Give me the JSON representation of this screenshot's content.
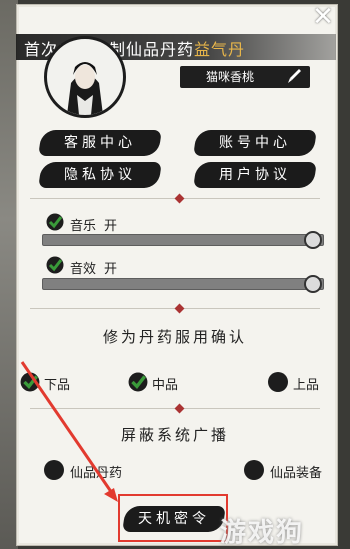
{
  "banner": {
    "prefix": "首次成功炼制仙品丹药",
    "highlight": "益气丹"
  },
  "player": {
    "name": "猫咪香桃"
  },
  "buttons": {
    "customer_service": "客服中心",
    "account_center": "账号中心",
    "privacy_policy": "隐私协议",
    "user_agreement": "用户协议"
  },
  "audio": {
    "music": {
      "label": "音乐",
      "state": "开",
      "level": 1.0
    },
    "sfx": {
      "label": "音效",
      "state": "开",
      "level": 1.0
    }
  },
  "pill_confirm": {
    "title": "修为丹药服用确认",
    "options": [
      {
        "label": "下品",
        "checked": true
      },
      {
        "label": "中品",
        "checked": true
      },
      {
        "label": "上品",
        "checked": false
      }
    ]
  },
  "broadcast": {
    "title": "屏蔽系统广播",
    "options": [
      {
        "label": "仙品丹药",
        "checked": false
      },
      {
        "label": "仙品装备",
        "checked": false
      }
    ]
  },
  "secret_button": "天机密令",
  "watermark": "游戏狗",
  "colors": {
    "accent": "#e8b64a",
    "highlight_box": "#e23a2f",
    "check": "#3a9a3a"
  }
}
